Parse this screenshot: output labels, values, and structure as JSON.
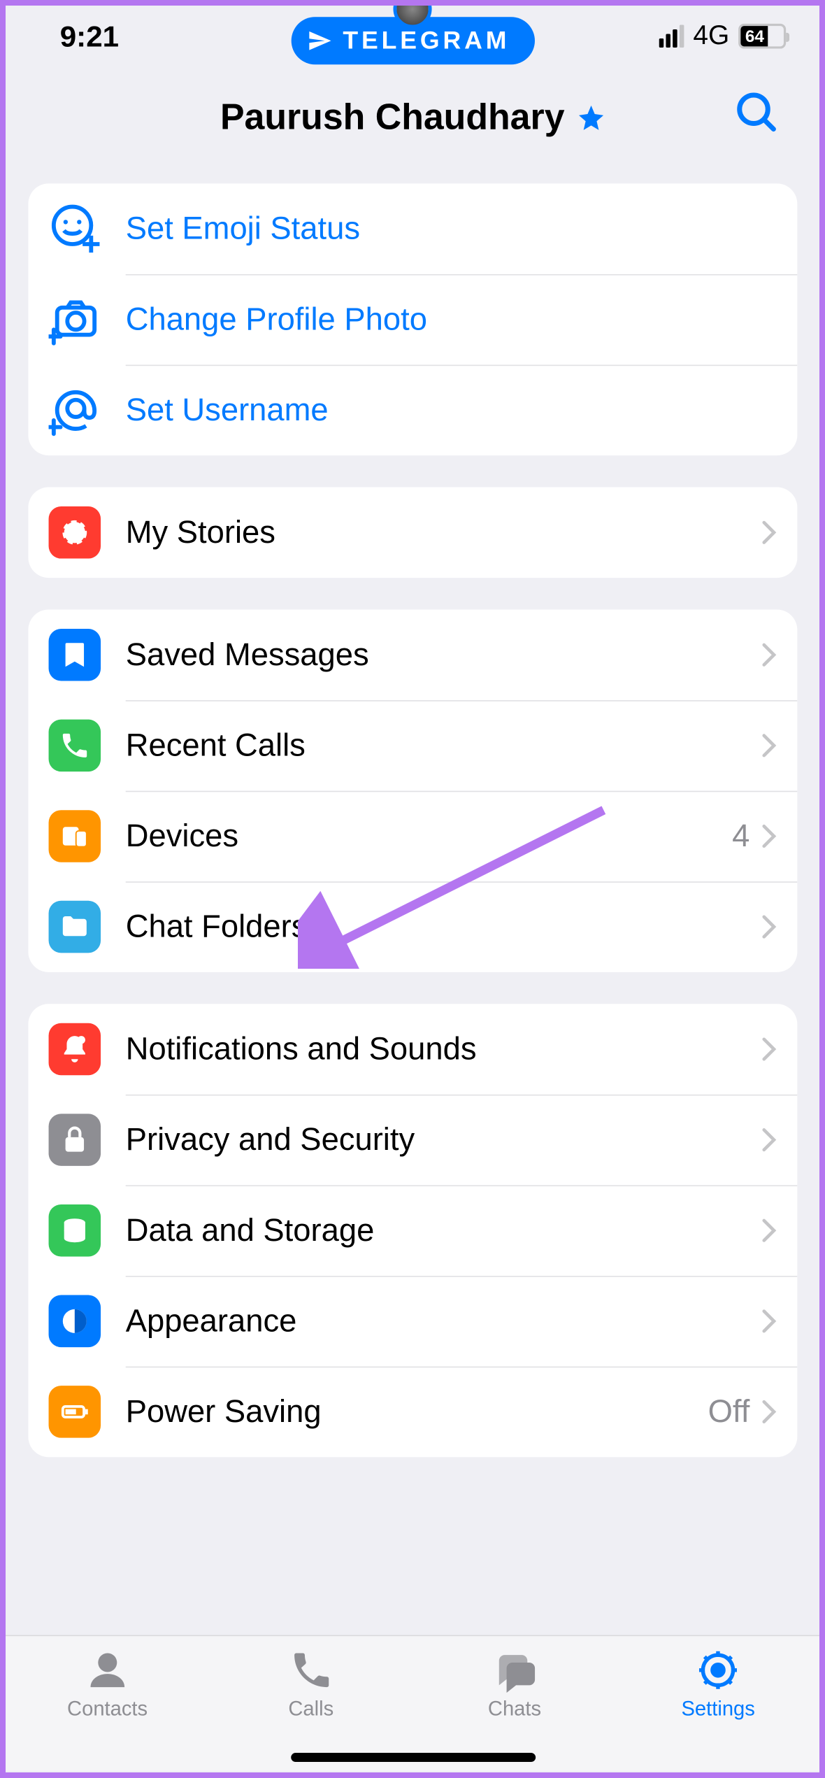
{
  "status": {
    "time": "9:21",
    "network": "4G",
    "battery_pct": "64"
  },
  "pill": {
    "label": "TELEGRAM"
  },
  "header": {
    "title": "Paurush Chaudhary"
  },
  "sections": {
    "profile": [
      {
        "label": "Set Emoji Status"
      },
      {
        "label": "Change Profile Photo"
      },
      {
        "label": "Set Username"
      }
    ],
    "stories": [
      {
        "label": "My Stories"
      }
    ],
    "chats": [
      {
        "label": "Saved Messages"
      },
      {
        "label": "Recent Calls"
      },
      {
        "label": "Devices",
        "value": "4"
      },
      {
        "label": "Chat Folders"
      }
    ],
    "settings": [
      {
        "label": "Notifications and Sounds"
      },
      {
        "label": "Privacy and Security"
      },
      {
        "label": "Data and Storage"
      },
      {
        "label": "Appearance"
      },
      {
        "label": "Power Saving",
        "value": "Off"
      }
    ]
  },
  "tabs": [
    {
      "label": "Contacts"
    },
    {
      "label": "Calls"
    },
    {
      "label": "Chats"
    },
    {
      "label": "Settings"
    }
  ]
}
